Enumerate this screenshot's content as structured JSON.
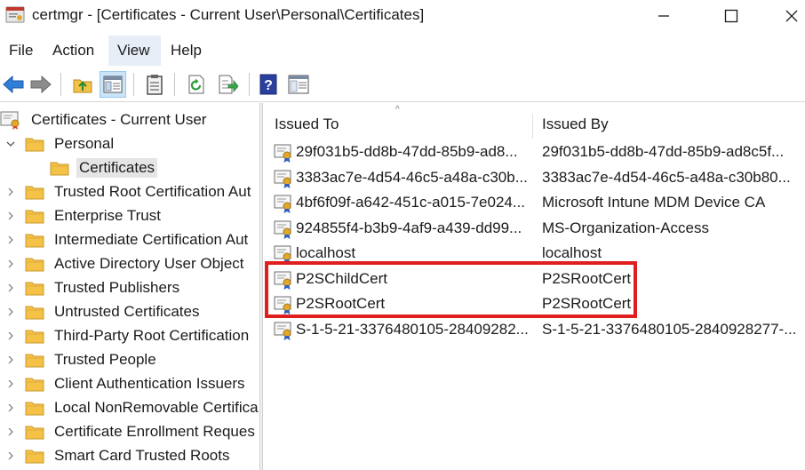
{
  "window": {
    "title": "certmgr - [Certificates - Current User\\Personal\\Certificates]",
    "minimize_glyph": "—",
    "maximize_glyph": "☐",
    "close_glyph": "✕"
  },
  "menu": [
    {
      "label": "File",
      "active": false
    },
    {
      "label": "Action",
      "active": false
    },
    {
      "label": "View",
      "active": true
    },
    {
      "label": "Help",
      "active": false
    }
  ],
  "toolbar": [
    {
      "icon": "back-arrow-icon"
    },
    {
      "icon": "forward-arrow-icon"
    },
    {
      "icon": "up-folder-icon"
    },
    {
      "icon": "show-hide-console-tree-icon",
      "pressed": true
    },
    {
      "icon": "clipboard-icon"
    },
    {
      "icon": "refresh-icon"
    },
    {
      "icon": "export-list-icon"
    },
    {
      "icon": "help-icon"
    },
    {
      "icon": "properties-icon"
    }
  ],
  "tree": {
    "root": "Certificates - Current User",
    "items": [
      {
        "label": "Personal",
        "level": 1,
        "expanded": true
      },
      {
        "label": "Certificates",
        "level": 2,
        "selected": true
      },
      {
        "label": "Trusted Root Certification Aut",
        "level": 1
      },
      {
        "label": "Enterprise Trust",
        "level": 1
      },
      {
        "label": "Intermediate Certification Aut",
        "level": 1
      },
      {
        "label": "Active Directory User Object",
        "level": 1
      },
      {
        "label": "Trusted Publishers",
        "level": 1
      },
      {
        "label": "Untrusted Certificates",
        "level": 1
      },
      {
        "label": "Third-Party Root Certification",
        "level": 1
      },
      {
        "label": "Trusted People",
        "level": 1
      },
      {
        "label": "Client Authentication Issuers",
        "level": 1
      },
      {
        "label": "Local NonRemovable Certifica",
        "level": 1
      },
      {
        "label": "Certificate Enrollment Reques",
        "level": 1
      },
      {
        "label": "Smart Card Trusted Roots",
        "level": 1
      }
    ]
  },
  "list": {
    "columns": [
      "Issued To",
      "Issued By"
    ],
    "sort_glyph": "^",
    "rows": [
      {
        "issued_to": "29f031b5-dd8b-47dd-85b9-ad8...",
        "issued_by": "29f031b5-dd8b-47dd-85b9-ad8c5f..."
      },
      {
        "issued_to": "3383ac7e-4d54-46c5-a48a-c30b...",
        "issued_by": "3383ac7e-4d54-46c5-a48a-c30b80..."
      },
      {
        "issued_to": "4bf6f09f-a642-451c-a015-7e024...",
        "issued_by": "Microsoft Intune MDM Device CA"
      },
      {
        "issued_to": "924855f4-b3b9-4af9-a439-dd99...",
        "issued_by": "MS-Organization-Access"
      },
      {
        "issued_to": "localhost",
        "issued_by": "localhost"
      },
      {
        "issued_to": "P2SChildCert",
        "issued_by": "P2SRootCert"
      },
      {
        "issued_to": "P2SRootCert",
        "issued_by": "P2SRootCert"
      },
      {
        "issued_to": "S-1-5-21-3376480105-28409282...",
        "issued_by": "S-1-5-21-3376480105-2840928277-..."
      }
    ]
  },
  "colors": {
    "highlight": "#e01e1e",
    "folder": "#f4c247",
    "accent_blue": "#2f7ed8"
  }
}
